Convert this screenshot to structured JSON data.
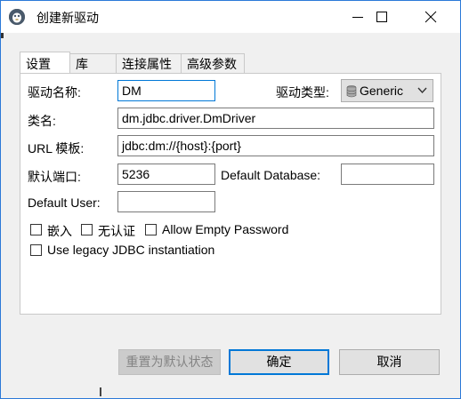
{
  "window": {
    "title": "创建新驱动"
  },
  "tabs": [
    {
      "label": "设置",
      "active": true
    },
    {
      "label": "库",
      "active": false
    },
    {
      "label": "连接属性",
      "active": false
    },
    {
      "label": "高级参数",
      "active": false
    }
  ],
  "form": {
    "driver_name_label": "驱动名称:",
    "driver_name_value": "DM",
    "driver_type_label": "驱动类型:",
    "driver_type_value": "Generic",
    "class_name_label": "类名:",
    "class_name_value": "dm.jdbc.driver.DmDriver",
    "url_template_label": "URL 模板:",
    "url_template_value": "jdbc:dm://{host}:{port}",
    "default_port_label": "默认端口:",
    "default_port_value": "5236",
    "default_database_label": "Default Database:",
    "default_database_value": "",
    "default_user_label": "Default User:",
    "default_user_value": ""
  },
  "options": {
    "embedded_label": "嵌入",
    "no_auth_label": "无认证",
    "allow_empty_password_label": "Allow Empty Password",
    "legacy_jdbc_label": "Use legacy JDBC instantiation"
  },
  "buttons": {
    "reset_label": "重置为默认状态",
    "ok_label": "确定",
    "cancel_label": "取消"
  },
  "colors": {
    "accent": "#0078d7",
    "window_border": "#2b79d8",
    "panel_bg": "#ffffff",
    "dialog_bg": "#f0f0f0"
  },
  "icons": {
    "app": "dbeaver-beaver-icon",
    "minimize": "minimize-icon",
    "maximize": "maximize-icon",
    "close": "close-icon",
    "driver_type": "database-icon",
    "dropdown": "chevron-down-icon"
  }
}
